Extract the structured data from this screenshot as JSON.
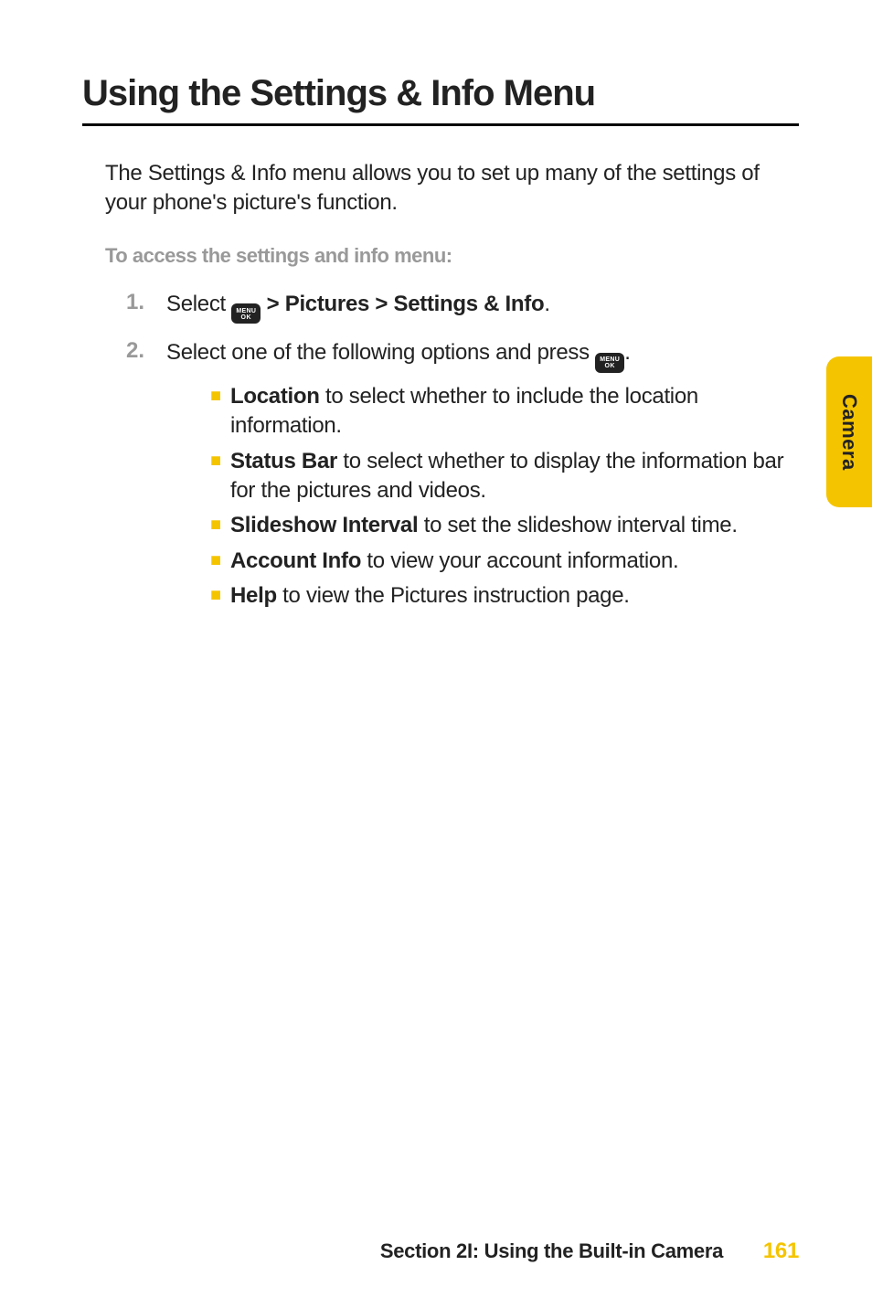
{
  "title": "Using the Settings & Info Menu",
  "intro": "The Settings & Info menu allows you to set up many of the settings of your phone's picture's function.",
  "subhead": "To access the settings and info menu:",
  "menu_key": {
    "line1": "MENU",
    "line2": "OK"
  },
  "steps": {
    "s1": {
      "num": "1.",
      "prefix": "Select ",
      "bold_suffix": " > Pictures > Settings & Info",
      "period": "."
    },
    "s2": {
      "num": "2.",
      "prefix": "Select one of the following options and press ",
      "period": "."
    }
  },
  "bullets": [
    {
      "bold": "Location",
      "rest": " to select whether to include the location information."
    },
    {
      "bold": "Status Bar",
      "rest": " to select whether to display the information bar for the pictures and videos."
    },
    {
      "bold": "Slideshow Interval",
      "rest": " to set the slideshow interval time."
    },
    {
      "bold": "Account Info",
      "rest": " to view your account information."
    },
    {
      "bold": "Help",
      "rest": " to view the Pictures instruction page."
    }
  ],
  "side_tab": "Camera",
  "footer": {
    "section": "Section 2I: Using the Built-in Camera",
    "page": "161"
  }
}
